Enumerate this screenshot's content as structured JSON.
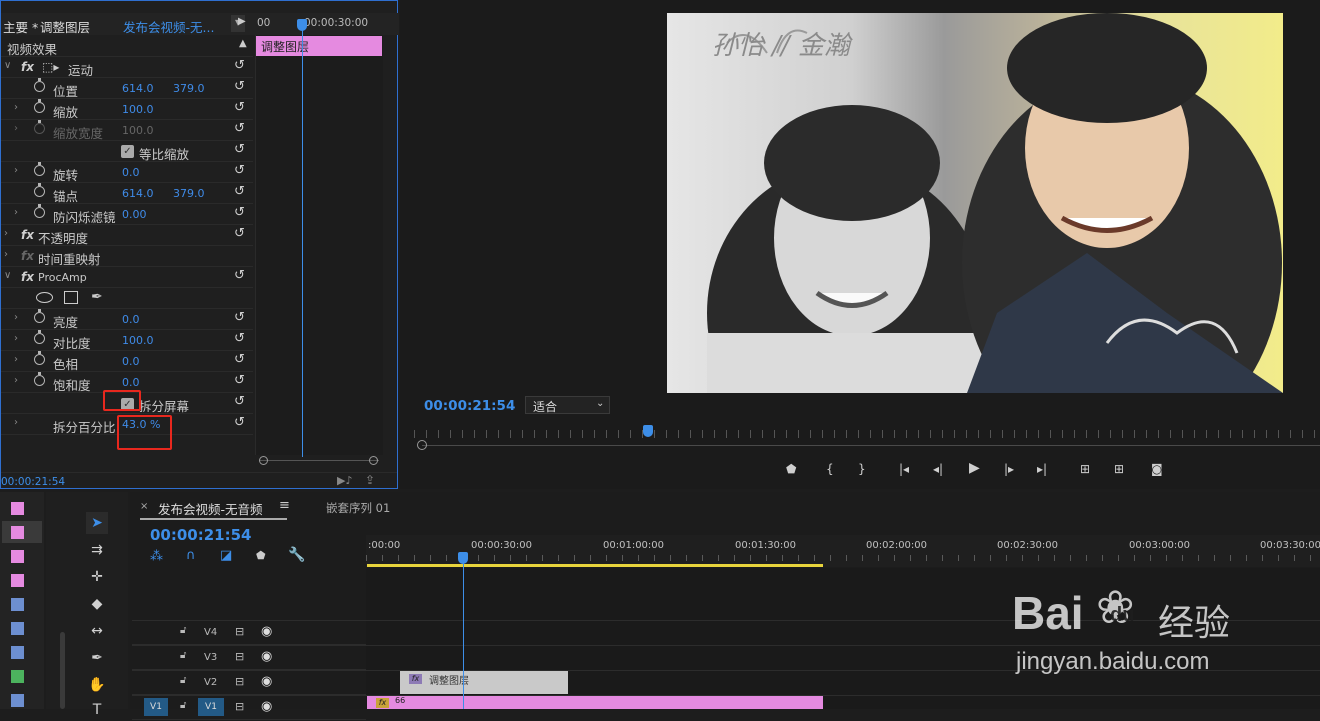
{
  "effect_controls": {
    "tab_master": "主要 *",
    "tab_master_clip": "调整图层",
    "tab_sequence": "发布会视频-无...",
    "mini_time_0": "00",
    "mini_time_1": "00:00:30:00",
    "clip_label": "调整图层",
    "section_video": "视频效果",
    "motion": "运动",
    "position": "位置",
    "position_x": "614.0",
    "position_y": "379.0",
    "scale": "缩放",
    "scale_val": "100.0",
    "scale_width": "缩放宽度",
    "scale_width_val": "100.0",
    "uniform_scale": "等比缩放",
    "rotation": "旋转",
    "rotation_val": "0.0",
    "anchor": "锚点",
    "anchor_x": "614.0",
    "anchor_y": "379.0",
    "antiflicker": "防闪烁滤镜",
    "antiflicker_val": "0.00",
    "opacity": "不透明度",
    "time_remap": "时间重映射",
    "procamp": "ProcAmp",
    "brightness": "亮度",
    "brightness_val": "0.0",
    "contrast": "对比度",
    "contrast_val": "100.0",
    "hue": "色相",
    "hue_val": "0.0",
    "saturation": "饱和度",
    "saturation_val": "0.0",
    "split_screen": "拆分屏幕",
    "split_percent": "拆分百分比",
    "split_percent_val": "43.0 %",
    "current_time": "00:00:21:54"
  },
  "program_monitor": {
    "timecode": "00:00:21:54",
    "fit_label": "适合",
    "image_text": "孙怡 // 金瀚"
  },
  "timeline": {
    "tab_active": "发布会视频-无音频",
    "tab_nested": "嵌套序列 01",
    "timecode": "00:00:21:54",
    "ruler": [
      ":00:00",
      "00:00:30:00",
      "00:01:00:00",
      "00:01:30:00",
      "00:02:00:00",
      "00:02:30:00",
      "00:03:00:00",
      "00:03:30:00"
    ],
    "tracks": [
      "V4",
      "V3",
      "V2",
      "V1"
    ],
    "v1_left": "V1",
    "clip_adjust": "调整图层",
    "clip_v1": "66"
  },
  "watermark": {
    "brand": "Bai",
    "brand2": "du",
    "brand_cn": "经验",
    "url": "jingyan.baidu.com"
  },
  "colors": {
    "accent_blue": "#2e7de1",
    "clip_pink": "#e58ae0",
    "playhead": "#3d8ee8",
    "highlight_red": "#e8281e"
  }
}
